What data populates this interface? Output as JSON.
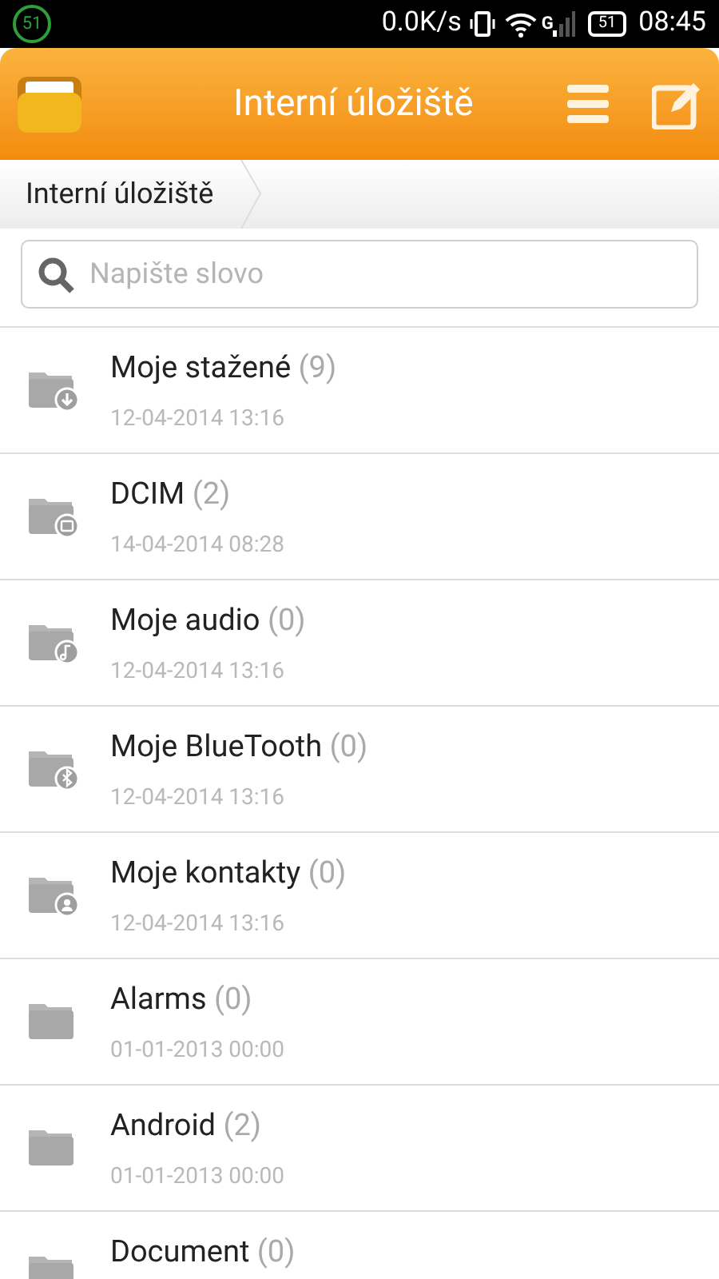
{
  "status_bar": {
    "notification_count": "51",
    "speed": "0.0K/s",
    "network": "G",
    "battery": "51",
    "time": "08:45"
  },
  "header": {
    "title": "Interní úložiště"
  },
  "breadcrumb": [
    "Interní úložiště"
  ],
  "search": {
    "placeholder": "Napište slovo"
  },
  "folders": [
    {
      "name": "Moje stažené",
      "count": "(9)",
      "date": "12-04-2014 13:16",
      "kind": "download"
    },
    {
      "name": "DCIM",
      "count": "(2)",
      "date": "14-04-2014 08:28",
      "kind": "image"
    },
    {
      "name": "Moje audio",
      "count": "(0)",
      "date": "12-04-2014 13:16",
      "kind": "music"
    },
    {
      "name": "Moje BlueTooth",
      "count": "(0)",
      "date": "12-04-2014 13:16",
      "kind": "bluetooth"
    },
    {
      "name": "Moje kontakty",
      "count": "(0)",
      "date": "12-04-2014 13:16",
      "kind": "contact"
    },
    {
      "name": "Alarms",
      "count": "(0)",
      "date": "01-01-2013 00:00",
      "kind": "plain"
    },
    {
      "name": "Android",
      "count": "(2)",
      "date": "01-01-2013 00:00",
      "kind": "plain"
    },
    {
      "name": "Document",
      "count": "(0)",
      "kind": "plain"
    }
  ]
}
